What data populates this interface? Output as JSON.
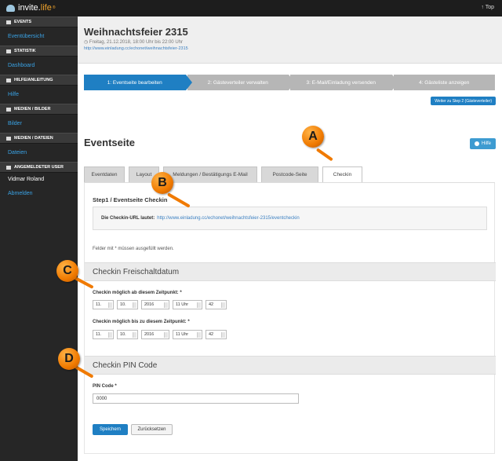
{
  "app": {
    "logo_a": "invite.",
    "logo_b": "life",
    "logo_badge": "®",
    "top_link": "Top"
  },
  "sidebar": {
    "sections": [
      {
        "head": "EVENTS",
        "links": [
          "Eventübersicht"
        ]
      },
      {
        "head": "STATISTIK",
        "links": [
          "Dashboard"
        ]
      },
      {
        "head": "HILFE/ANLEITUNG",
        "links": [
          "Hilfe"
        ]
      },
      {
        "head": "MEDIEN / BILDER",
        "links": [
          "Bilder"
        ]
      },
      {
        "head": "MEDIEN / DATEIEN",
        "links": [
          "Dateien"
        ]
      },
      {
        "head": "ANGEMELDETER USER",
        "links": []
      }
    ],
    "user_name": "Vidmar Roland",
    "logout": "Abmelden"
  },
  "event": {
    "title": "Weihnachtsfeier 2315",
    "date": "Freitag, 21.12.2018, 18:00 Uhr bis 22:00 Uhr",
    "url": "http://www.einladung.cc/echonet/weihnachtsfeier-2315"
  },
  "wizard": {
    "steps": [
      "1: Eventseite bearbeiten",
      "2: Gästeverteiler verwalten",
      "3: E-Mail/Einladung versenden",
      "4: Gästeliste anzeigen"
    ],
    "next_button": "Weiter zu Step 2 (Gästeverteiler)"
  },
  "page": {
    "heading": "Eventseite",
    "help": "Hilfe"
  },
  "tabs": [
    "Eventdaten",
    "Layout",
    "Meldungen / Bestätigungs E-Mail",
    "Postcode-Seite",
    "Checkin"
  ],
  "checkin": {
    "step_title": "Step1 / Eventseite Checkin",
    "url_label": "Die Checkin-URL lautet:",
    "url": "http://www.einladung.cc/echonet/weihnachtsfeier-2315/eventcheckin",
    "required_note": "Felder mit * müssen ausgefüllt werden."
  },
  "freischalt": {
    "section": "Checkin Freischaltdatum",
    "from_label": "Checkin möglich ab diesem Zeitpunkt: *",
    "from": [
      "11.",
      "10.",
      "2016",
      "11 Uhr",
      "42"
    ],
    "to_label": "Checkin möglich bis zu diesem Zeitpunkt: *",
    "to": [
      "11.",
      "10.",
      "2016",
      "11 Uhr",
      "42"
    ]
  },
  "pin": {
    "section": "Checkin PIN Code",
    "label": "PIN Code *",
    "value": "0000"
  },
  "buttons": {
    "save": "Speichern",
    "reset": "Zurücksetzen"
  },
  "markers": [
    "A",
    "B",
    "C",
    "D"
  ],
  "colors": {
    "accent": "#1f7fc3",
    "marker": "#f07a00",
    "sidebar": "#262626"
  }
}
